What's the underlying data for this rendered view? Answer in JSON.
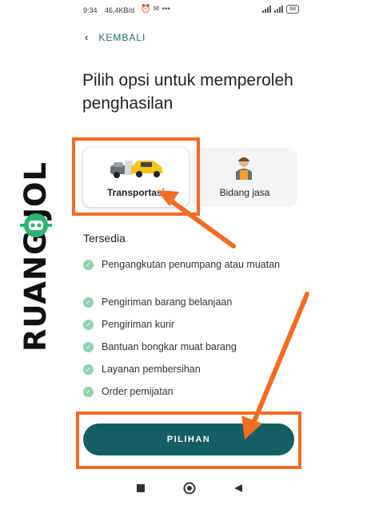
{
  "status_bar": {
    "time": "9:34",
    "net_speed": "46,4KB/d",
    "icons": "⏰ ✉ •••",
    "battery": "68"
  },
  "back": {
    "label": "KEMBALI"
  },
  "title": "Pilih opsi untuk memperoleh penghasilan",
  "options": [
    {
      "label": "Transportasi",
      "icon": "vehicles-icon",
      "selected": true
    },
    {
      "label": "Bidang jasa",
      "icon": "worker-icon",
      "selected": false
    }
  ],
  "available": {
    "heading": "Tersedia",
    "items": [
      "Pengangkutan penumpang atau muatan",
      "Pengiriman barang belanjaan",
      "Pengiriman kurir",
      "Bantuan bongkar muat barang",
      "Layanan pembersihan",
      "Order pemijatan"
    ]
  },
  "primary_button": {
    "label": "PILIHAN"
  },
  "watermark": {
    "text": "RUANG JOL"
  },
  "colors": {
    "accent": "#145f66",
    "check": "#8fd3b0",
    "highlight": "#f26c22"
  }
}
